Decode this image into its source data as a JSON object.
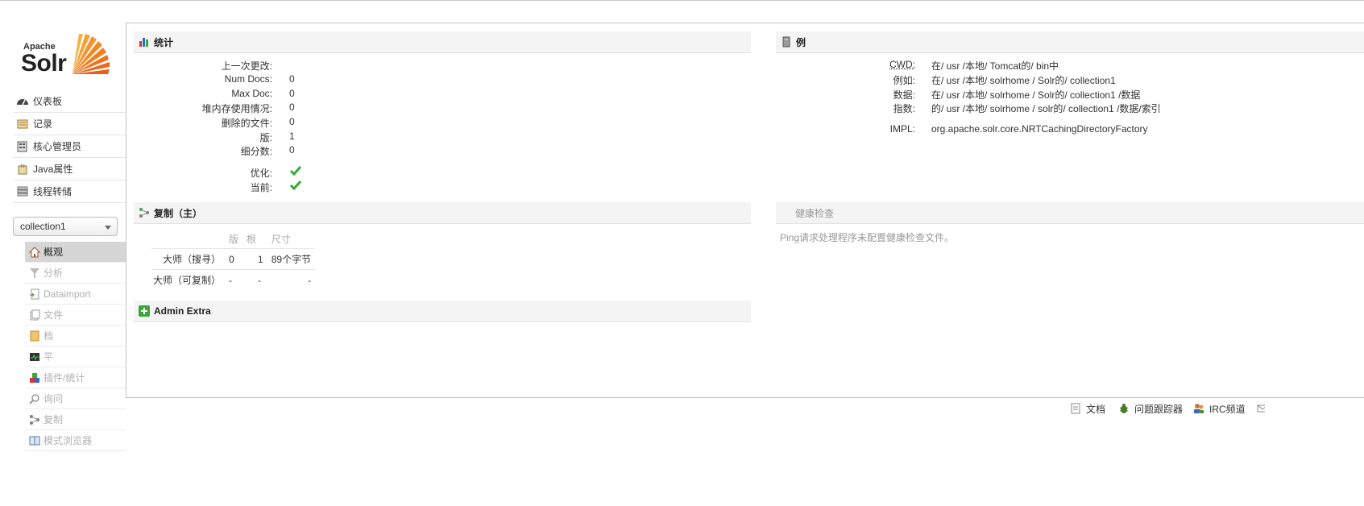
{
  "brand": {
    "apache": "Apache",
    "solr": "Solr"
  },
  "nav": [
    {
      "label": "仪表板",
      "icon": "dashboard-icon"
    },
    {
      "label": "记录",
      "icon": "logging-icon"
    },
    {
      "label": "核心管理员",
      "icon": "core-admin-icon"
    },
    {
      "label": "Java属性",
      "icon": "java-properties-icon"
    },
    {
      "label": "线程转储",
      "icon": "thread-dump-icon"
    }
  ],
  "core_selector": {
    "value": "collection1"
  },
  "core_nav": [
    {
      "label": "概观",
      "icon": "home-icon",
      "active": true
    },
    {
      "label": "分析",
      "icon": "analysis-icon"
    },
    {
      "label": "Dataimport",
      "icon": "dataimport-icon"
    },
    {
      "label": "文件",
      "icon": "files-icon"
    },
    {
      "label": "档",
      "icon": "documents-icon"
    },
    {
      "label": "平",
      "icon": "ping-icon"
    },
    {
      "label": "插件/统计",
      "icon": "plugins-icon"
    },
    {
      "label": "询问",
      "icon": "query-icon"
    },
    {
      "label": "复制",
      "icon": "replication-icon"
    },
    {
      "label": "模式浏览器",
      "icon": "schema-browser-icon"
    }
  ],
  "stats": {
    "title": "统计",
    "rows": [
      {
        "label": "上一次更改:",
        "value": ""
      },
      {
        "label": "Num Docs:",
        "value": "0"
      },
      {
        "label": "Max Doc:",
        "value": "0"
      },
      {
        "label": "堆内存使用情况:",
        "value": "0"
      },
      {
        "label": "删除的文件:",
        "value": "0"
      },
      {
        "label": "版:",
        "value": "1"
      },
      {
        "label": "细分数:",
        "value": "0"
      }
    ],
    "optimized_label": "优化:",
    "current_label": "当前:"
  },
  "instance": {
    "title": "例",
    "rows": [
      {
        "label": "CWD:",
        "value": "在/ usr /本地/ Tomcat的/ bin中"
      },
      {
        "label": "例如:",
        "value": "在/ usr /本地/ solrhome / Solr的/ collection1"
      },
      {
        "label": "数据:",
        "value": "在/ usr /本地/ solrhome / Solr的/ collection1 /数据"
      },
      {
        "label": "指数:",
        "value": "的/ usr /本地/ solrhome / solr的/ collection1 /数据/索引"
      }
    ],
    "impl_label": "IMPL:",
    "impl_value": "org.apache.solr.core.NRTCachingDirectoryFactory"
  },
  "replication": {
    "title": "复制（主）",
    "headers": [
      "",
      "版",
      "根",
      "尺寸"
    ],
    "rows": [
      [
        "大师（搜寻）",
        "0",
        "1",
        "89个字节"
      ],
      [
        "大师（可复制）",
        "-",
        "-",
        "-"
      ]
    ]
  },
  "healthcheck": {
    "title": "健康检查",
    "message": "Ping请求处理程序未配置健康检查文件。"
  },
  "admin_extra": {
    "title": "Admin Extra"
  },
  "footer": [
    {
      "label": "文档",
      "icon": "documentation-icon"
    },
    {
      "label": "问题跟踪器",
      "icon": "bug-icon"
    },
    {
      "label": "IRC频道",
      "icon": "irc-icon"
    }
  ],
  "colors": {
    "check_green": "#3aa63a",
    "logo_orange": "#f08a24"
  }
}
